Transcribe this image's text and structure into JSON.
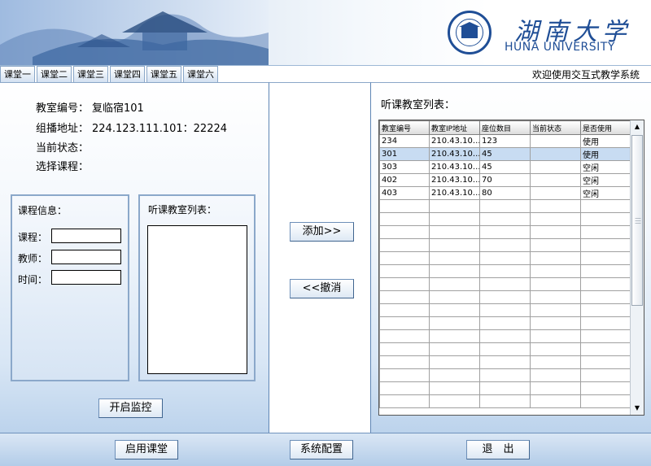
{
  "header": {
    "logo_cn": "湖南大学",
    "logo_en": "HUNA UNIVERSITY"
  },
  "tabs": [
    "课堂一",
    "课堂二",
    "课堂三",
    "课堂四",
    "课堂五",
    "课堂六"
  ],
  "welcome": "欢迎使用交互式教学系统",
  "left": {
    "classroom_label": "教室编号：",
    "classroom_value": "复临宿101",
    "multicast_label": "组播地址：",
    "multicast_value": "224.123.111.101：22224",
    "status_label": "当前状态：",
    "status_value": "",
    "course_select_label": "选择课程：",
    "course_info_title": "课程信息：",
    "course_label": "课程：",
    "teacher_label": "教师：",
    "time_label": "时间：",
    "course_value": "",
    "teacher_value": "",
    "time_value": "",
    "listen_list_title": "听课教室列表：",
    "start_monitor": "开启监控"
  },
  "middle": {
    "add": "添加>>",
    "cancel": "<<撤消"
  },
  "right": {
    "title": "听课教室列表：",
    "columns": [
      "教室编号",
      "教室IP地址",
      "座位数目",
      "当前状态",
      "是否使用"
    ],
    "rows": [
      [
        "234",
        "210.43.10...",
        "123",
        "",
        "使用"
      ],
      [
        "301",
        "210.43.10...",
        "45",
        "",
        "使用"
      ],
      [
        "303",
        "210.43.10...",
        "45",
        "",
        "空闲"
      ],
      [
        "402",
        "210.43.10...",
        "70",
        "",
        "空闲"
      ],
      [
        "403",
        "210.43.10...",
        "80",
        "",
        "空闲"
      ]
    ],
    "selected_row": 1
  },
  "footer": {
    "enable": "启用课堂",
    "config": "系统配置",
    "exit": "退　出"
  },
  "colors": {
    "brand": "#1f4e96",
    "panel_border": "#5f86b5",
    "selected_row": "#c8dcf2"
  }
}
